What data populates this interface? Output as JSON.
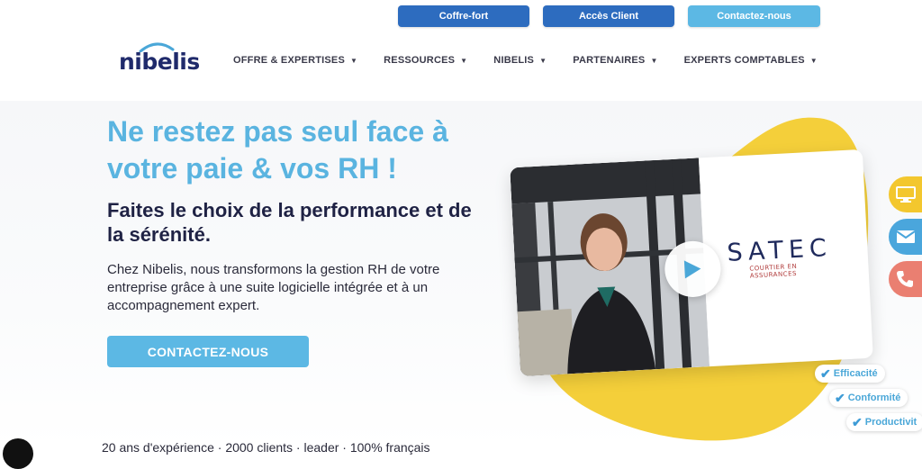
{
  "topbar": {
    "vault_label": "Coffre-fort",
    "client_label": "Accès Client",
    "contact_label": "Contactez-nous"
  },
  "logo": {
    "text": "nibelis"
  },
  "nav": {
    "items": [
      {
        "label": "OFFRE & EXPERTISES"
      },
      {
        "label": "RESSOURCES"
      },
      {
        "label": "NIBELIS"
      },
      {
        "label": "PARTENAIRES"
      },
      {
        "label": "EXPERTS COMPTABLES"
      }
    ]
  },
  "hero": {
    "headline": "Ne restez pas seul face à votre paie & vos RH !",
    "subheadline": "Faites le choix de la performance et de la sérénité.",
    "body": "Chez Nibelis, nous transformons la gestion RH de votre entreprise grâce à une suite logicielle intégrée et à un accompagnement expert.",
    "cta_label": "CONTACTEZ-NOUS"
  },
  "video": {
    "brand": "SATEC",
    "brand_sub": "COURTIER EN ASSURANCES"
  },
  "tags": [
    {
      "label": "Efficacité"
    },
    {
      "label": "Conformité"
    },
    {
      "label": "Productivit"
    }
  ],
  "side_actions": [
    "screen-icon",
    "mail-icon",
    "phone-icon"
  ],
  "bottom": {
    "text": "20 ans d'expérience · 2000 clients · leader · 100% français"
  },
  "colors": {
    "primary_light": "#5cb8e4",
    "primary_dark": "#2d6cbf",
    "navy": "#1f2244",
    "yellow": "#f4cf3a",
    "coral": "#ea7f71"
  }
}
